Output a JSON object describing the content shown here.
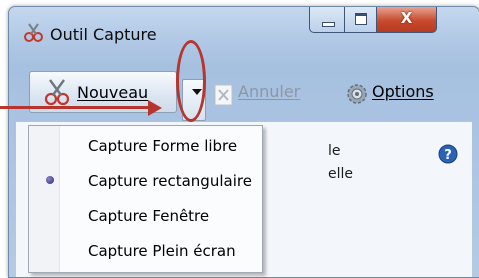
{
  "window": {
    "title": "Outil Capture",
    "close_glyph": "X"
  },
  "toolbar": {
    "new_label": "Nouveau",
    "cancel_label": "Annuler",
    "options_label": "Options"
  },
  "menu": {
    "items": [
      {
        "label": "Capture Forme libre",
        "selected": false
      },
      {
        "label": "Capture rectangulaire",
        "selected": true
      },
      {
        "label": "Capture Fenêtre",
        "selected": false
      },
      {
        "label": "Capture Plein écran",
        "selected": false
      }
    ]
  },
  "body": {
    "hint_line1": "le",
    "hint_line2": "elle"
  },
  "icons": {
    "app": "scissors-icon",
    "new": "scissors-icon",
    "cancel": "cancel-x-icon",
    "options": "gear-icon",
    "help": "help-icon"
  },
  "colors": {
    "annotation": "#b6352c",
    "title_gradient_top": "#c4d7ee",
    "close_button": "#c74a2e",
    "disabled_text": "#8d97a4"
  }
}
